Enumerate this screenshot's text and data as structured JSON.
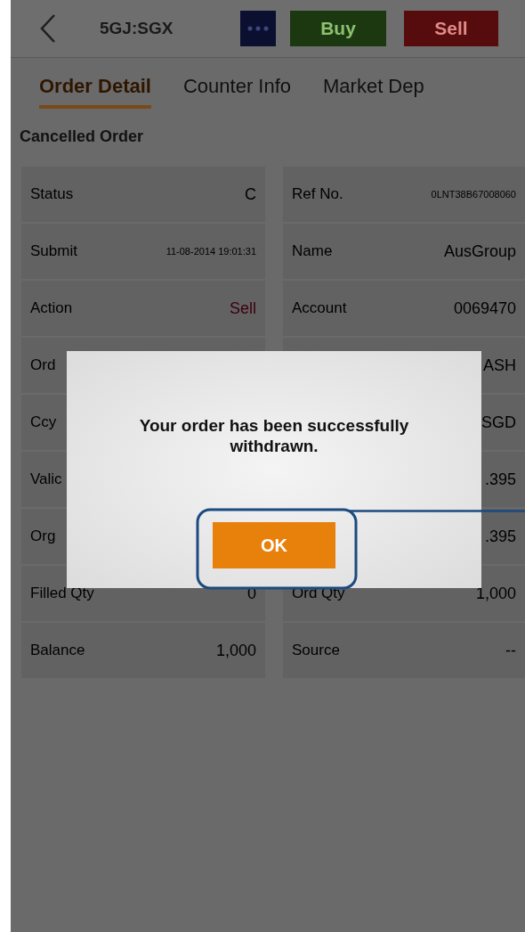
{
  "header": {
    "symbol": "5GJ:SGX",
    "buttons": [
      {
        "kind": "more"
      },
      {
        "kind": "buy",
        "label": "Buy"
      },
      {
        "kind": "sell",
        "label": "Sell"
      }
    ]
  },
  "tabs": [
    {
      "label": "Order Detail",
      "selected": true
    },
    {
      "label": "Counter Info",
      "selected": false
    },
    {
      "label": "Market Dep",
      "selected": false
    }
  ],
  "section_title": "Cancelled Order",
  "rows": [
    {
      "left": {
        "label": "Status",
        "value": "C"
      },
      "right": {
        "label": "Ref No.",
        "value": "0LNT38B67008060",
        "small": true
      }
    },
    {
      "left": {
        "label": "Submit",
        "value": "11-08-2014 19:01:31",
        "small": true
      },
      "right": {
        "label": "Name",
        "value": "AusGroup"
      }
    },
    {
      "left": {
        "label": "Action",
        "value": "Sell",
        "color": "#3a0010"
      },
      "right": {
        "label": "Account",
        "value": "0069470"
      }
    },
    {
      "left": {
        "label": "Ord"
      },
      "right": {
        "value": "ASH"
      }
    },
    {
      "left": {
        "label": "Ccy"
      },
      "right": {
        "value": "SGD"
      }
    },
    {
      "left": {
        "label": "Valic"
      },
      "right": {
        "value": ".395"
      }
    },
    {
      "left": {
        "label": "Org"
      },
      "right": {
        "value": ".395"
      }
    },
    {
      "left": {
        "label": "Filled Qty",
        "value": "0"
      },
      "right": {
        "label": "Ord Qty",
        "value": "1,000"
      }
    },
    {
      "left": {
        "label": "Balance",
        "value": "1,000"
      },
      "right": {
        "label": "Source",
        "value": "--"
      }
    }
  ],
  "dialog": {
    "message": "Your order has been successfully withdrawn.",
    "button": "OK"
  }
}
